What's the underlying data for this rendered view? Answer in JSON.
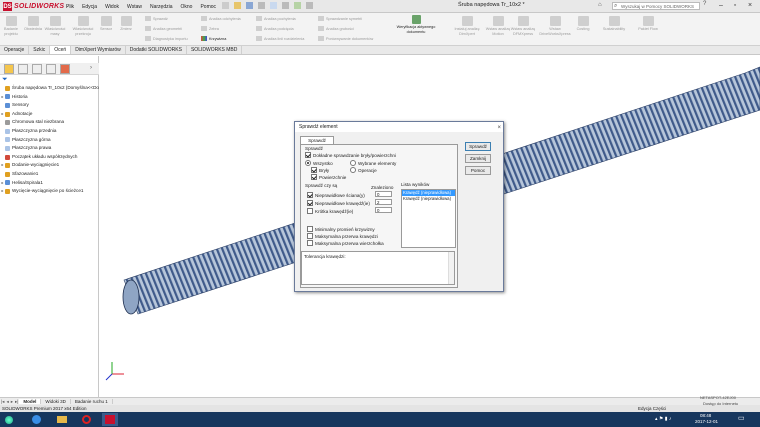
{
  "app": {
    "logo_text": "SOLIDWORKS",
    "logo_mark": "DS",
    "doc_title": "Śruba napędowa Tr_10x2 *",
    "help_placeholder": "Wyszukaj w Pomocy SOLIDWORKS"
  },
  "menu": [
    "Plik",
    "Edycja",
    "Widok",
    "Wstaw",
    "Narzędzia",
    "Okno",
    "Pomoc"
  ],
  "ribbon": {
    "big_buttons": [
      {
        "label": "Badanie projektu"
      },
      {
        "label": "Obwiednia"
      },
      {
        "label": "Właściwości masy"
      },
      {
        "label": "Właściwości przekroju"
      },
      {
        "label": "Sensor"
      },
      {
        "label": "Zmierz"
      }
    ],
    "col1": [
      "Sprawdź",
      "Analiza geometrii",
      "Diagnostyka importu"
    ],
    "col2": [
      "Analiza odchylenia",
      "Zebra",
      "Krzywizna"
    ],
    "col3": [
      "Analiza pochylenia",
      "Analiza podcięcia",
      "Analiza linii rozdzielenia"
    ],
    "col4": [
      "Sprawdzanie symetrii",
      "Analiza grubości",
      "Porównywanie dokumentów"
    ],
    "feature_button": {
      "label": "Weryfikacja aktywnego dokumentu"
    },
    "more_buttons": [
      "Instaluj analizę DimXpert",
      "Wstaw analizę Motion",
      "Wstaw analizę DFMXpress",
      "Wstaw DriveWorksXpress",
      "Costing",
      "Sustainability",
      "Pakiet Flow"
    ]
  },
  "tabs": [
    {
      "label": "Operacje",
      "active": false
    },
    {
      "label": "Szkic",
      "active": false
    },
    {
      "label": "Oceń",
      "active": true
    },
    {
      "label": "DimXpert Wymiarów",
      "active": false
    },
    {
      "label": "Dodatki SOLIDWORKS",
      "active": false
    },
    {
      "label": "SOLIDWORKS MBD",
      "active": false
    }
  ],
  "tree": [
    {
      "label": "Śruba napędowa Tr_10x2  (Domyślna<<Do",
      "icon_color": "#e0a020",
      "expander": ""
    },
    {
      "label": "Historia",
      "icon_color": "#5b8fd6",
      "expander": "▸"
    },
    {
      "label": "Sensory",
      "icon_color": "#5b8fd6",
      "expander": ""
    },
    {
      "label": "Adnotacje",
      "icon_color": "#e0a020",
      "expander": "▸"
    },
    {
      "label": "Chromowa stal niezbrana",
      "icon_color": "#9b9b9b",
      "expander": ""
    },
    {
      "label": "Płaszczyzna przednia",
      "icon_color": "#aac3e6",
      "expander": ""
    },
    {
      "label": "Płaszczyzna górna",
      "icon_color": "#aac3e6",
      "expander": ""
    },
    {
      "label": "Płaszczyzna prawa",
      "icon_color": "#aac3e6",
      "expander": ""
    },
    {
      "label": "Początek układu współrzędnych",
      "icon_color": "#d24a3a",
      "expander": ""
    },
    {
      "label": "Dodanie-wyciągnięcie1",
      "icon_color": "#e0a020",
      "expander": "▸"
    },
    {
      "label": "Sfazowanie1",
      "icon_color": "#e0a020",
      "expander": ""
    },
    {
      "label": "Helisa/Spirala1",
      "icon_color": "#5b8fd6",
      "expander": "▸"
    },
    {
      "label": "Wycięcie-wyciągnięcie po ścieżce1",
      "icon_color": "#e0a020",
      "expander": "▸"
    }
  ],
  "bottom_tabs": [
    {
      "label": "Model",
      "active": true
    },
    {
      "label": "Widoki 3D",
      "active": false
    },
    {
      "label": "Badanie ruchu 1",
      "active": false
    }
  ],
  "status": {
    "left": "SOLIDWORKS Premium 2017 x64 Edition",
    "mid": "Edycja Części",
    "right_note": "NETASPOT-42EJ00",
    "right_note2": "Dostęp do Internetu"
  },
  "taskbar": {
    "time": "08:48",
    "date": "2017-12-01"
  },
  "dialog": {
    "title": "Sprawdź element",
    "tab": "Sprawdź element",
    "group_check": "Sprawdź",
    "strict": {
      "label": "Dokładne sprawdzanie bryły/powierzchni",
      "checked": true
    },
    "radio_all": {
      "label": "Wszystko",
      "on": true
    },
    "radio_selected": {
      "label": "Wybrane elementy",
      "on": false
    },
    "solids": {
      "label": "Bryły",
      "checked": true
    },
    "surfaces": {
      "label": "Powierzchnie",
      "checked": true
    },
    "radio_feature": {
      "label": "Operacje",
      "on": false
    },
    "group_check_for": "Sprawdź czy są",
    "found_label": "Znaleziono",
    "invalid_faces": {
      "label": "Nieprawidłowe ściana(y)",
      "checked": true,
      "value": "0"
    },
    "invalid_edges": {
      "label": "Nieprawidłowe krawędź(ie)",
      "checked": true,
      "value": "2"
    },
    "short_edges": {
      "label": "Krótka krawędź(ie)",
      "checked": false,
      "value": "0"
    },
    "min_radius": {
      "label": "Minimalny promień krzywizny",
      "checked": false
    },
    "max_edge_gap": {
      "label": "Maksymalna przerwa krawędzi",
      "checked": false
    },
    "max_vertex_gap": {
      "label": "Maksymalna przerwa wierzchołka",
      "checked": false
    },
    "results_label": "Lista wyników",
    "results": [
      {
        "label": "Krawędź (nieprawidłowa)",
        "selected": true
      },
      {
        "label": "Krawędź (nieprawidłowa)",
        "selected": false
      }
    ],
    "info_text": "Tolerancja krawędzi:",
    "btn_check": "Sprawdź",
    "btn_close": "Zamknij",
    "btn_help": "Pomoc"
  }
}
